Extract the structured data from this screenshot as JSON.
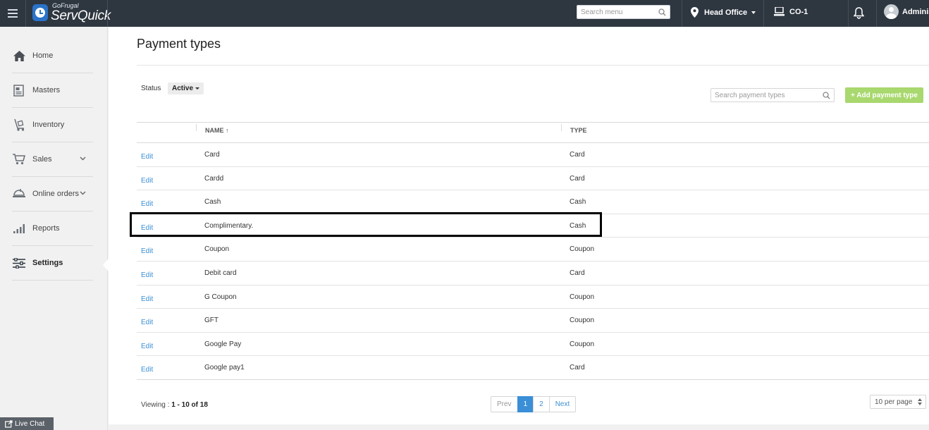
{
  "app": {
    "logo_small": "GoFrugal",
    "logo_big": "ServQuick"
  },
  "topbar": {
    "menu_search_placeholder": "Search menu",
    "location": "Head Office",
    "counter": "CO-1",
    "user": "Adminis"
  },
  "sidebar": {
    "items": [
      {
        "label": "Home",
        "icon": "home-icon"
      },
      {
        "label": "Masters",
        "icon": "masters-icon"
      },
      {
        "label": "Inventory",
        "icon": "inventory-icon"
      },
      {
        "label": "Sales",
        "icon": "cart-icon",
        "expandable": true
      },
      {
        "label": "Online orders",
        "icon": "online-orders-icon",
        "expandable": true
      },
      {
        "label": "Reports",
        "icon": "reports-icon"
      },
      {
        "label": "Settings",
        "icon": "settings-icon",
        "active": true
      }
    ],
    "live_chat": "Live Chat"
  },
  "page": {
    "title": "Payment types",
    "status_label": "Status",
    "status_value": "Active",
    "search_placeholder": "Search payment types",
    "add_button": "+ Add payment type"
  },
  "table": {
    "columns": [
      "NAME ↑",
      "TYPE"
    ],
    "edit_label": "Edit",
    "rows": [
      {
        "name": "Card",
        "type": "Card"
      },
      {
        "name": "Cardd",
        "type": "Card"
      },
      {
        "name": "Cash",
        "type": "Cash"
      },
      {
        "name": "Complimentary.",
        "type": "Cash",
        "highlighted": true
      },
      {
        "name": "Coupon",
        "type": "Coupon"
      },
      {
        "name": "Debit card",
        "type": "Card"
      },
      {
        "name": "G Coupon",
        "type": "Coupon"
      },
      {
        "name": "GFT",
        "type": "Coupon"
      },
      {
        "name": "Google Pay",
        "type": "Coupon"
      },
      {
        "name": "Google pay1",
        "type": "Card"
      }
    ]
  },
  "pagination": {
    "viewing_prefix": "Viewing : ",
    "viewing_range": "1 - 10 of 18",
    "prev": "Prev",
    "pages": [
      "1",
      "2"
    ],
    "current": "1",
    "next": "Next",
    "per_page": "10 per page"
  },
  "colors": {
    "topbar": "#2e3640",
    "accent": "#3a8fd6",
    "add_button": "#a8d86e"
  }
}
